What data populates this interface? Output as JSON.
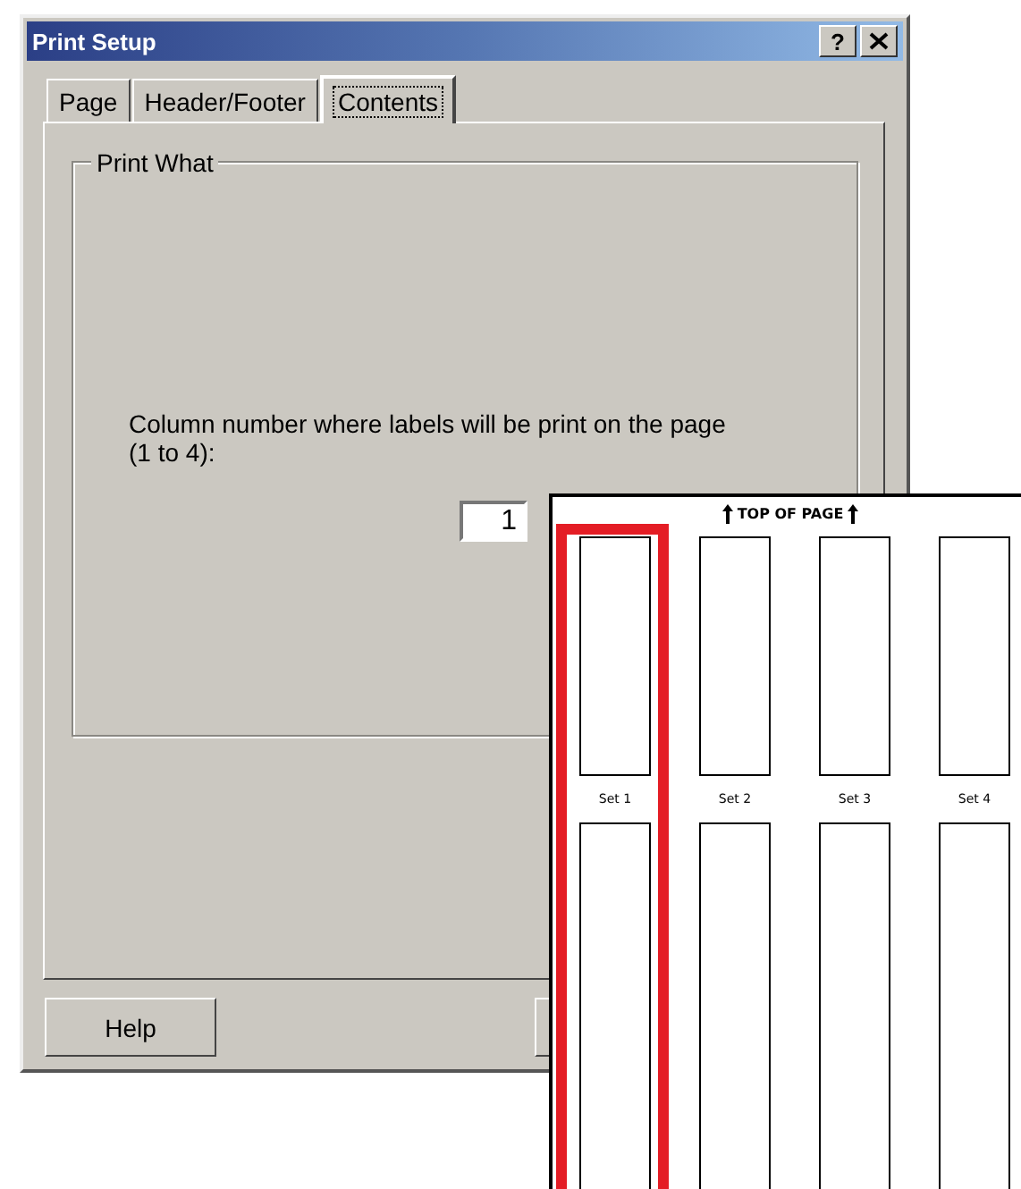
{
  "window": {
    "title": "Print Setup",
    "help_glyph": "?"
  },
  "tabs": [
    {
      "label": "Page",
      "selected": false
    },
    {
      "label": "Header/Footer",
      "selected": false
    },
    {
      "label": "Contents",
      "selected": true
    }
  ],
  "group": {
    "title": "Print What",
    "prompt": "Column number where labels will be print on the page\n(1 to 4):",
    "field_value": "1"
  },
  "buttons": [
    "Help"
  ],
  "overlay": {
    "heading": "TOP OF PAGE",
    "columns": [
      {
        "label": "Set 1",
        "selected": true
      },
      {
        "label": "Set 2",
        "selected": false
      },
      {
        "label": "Set 3",
        "selected": false
      },
      {
        "label": "Set 4",
        "selected": false
      }
    ]
  }
}
